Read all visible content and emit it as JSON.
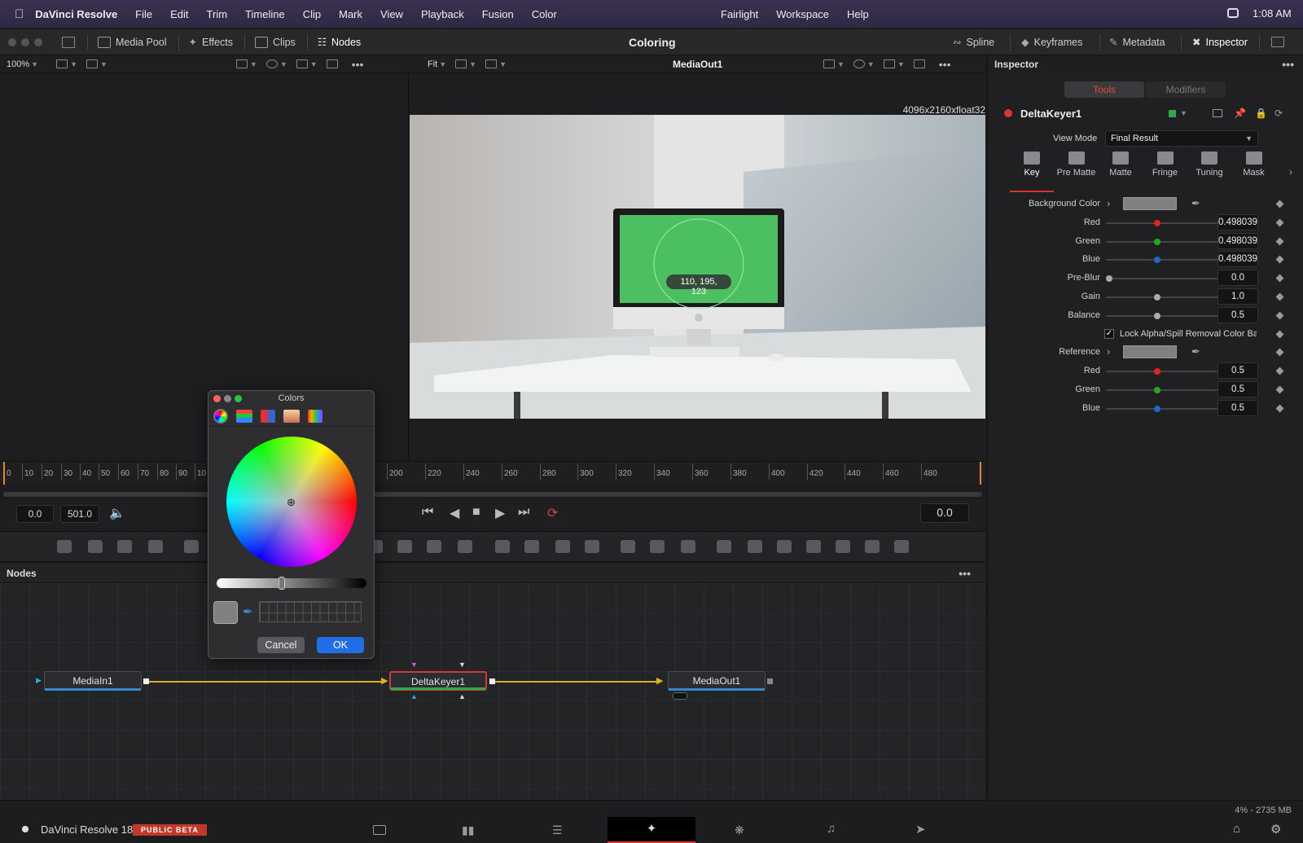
{
  "menubar": {
    "app_name": "DaVinci Resolve",
    "menus": [
      "File",
      "Edit",
      "Trim",
      "Timeline",
      "Clip",
      "Mark",
      "View",
      "Playback",
      "Fusion",
      "Color"
    ],
    "right_menus": [
      "Fairlight",
      "Workspace",
      "Help"
    ],
    "clock": "1:08 AM"
  },
  "toolbar": {
    "left": [
      "Media Pool",
      "Effects",
      "Clips",
      "Nodes"
    ],
    "title": "Coloring",
    "right": [
      "Spline",
      "Keyframes",
      "Metadata",
      "Inspector"
    ]
  },
  "viewer_left": {
    "zoom": "100%"
  },
  "viewer_right": {
    "fit": "Fit",
    "name": "MediaOut1",
    "resolution": "4096x2160xfloat32",
    "sample_readout": "110, 195, 123"
  },
  "timeline": {
    "labels": [
      "0",
      "10",
      "20",
      "30",
      "40",
      "50",
      "60",
      "70",
      "80",
      "90",
      "10",
      "200",
      "220",
      "240",
      "260",
      "280",
      "300",
      "320",
      "340",
      "360",
      "380",
      "400",
      "420",
      "440",
      "460",
      "480"
    ]
  },
  "transport": {
    "start": "0.0",
    "end": "501.0",
    "current": "0.0"
  },
  "nodes_panel": {
    "title": "Nodes",
    "nodes": [
      {
        "label": "MediaIn1",
        "bar_color": "#3a88c8"
      },
      {
        "label": "DeltaKeyer1",
        "bar_color": "#2fa84a"
      },
      {
        "label": "MediaOut1",
        "bar_color": "#3a88c8"
      }
    ]
  },
  "colors_dialog": {
    "title": "Colors",
    "cancel": "Cancel",
    "ok": "OK"
  },
  "inspector": {
    "title": "Inspector",
    "tab_tools": "Tools",
    "tab_modifiers": "Modifiers",
    "node_name": "DeltaKeyer1",
    "view_mode_label": "View Mode",
    "view_mode_value": "Final Result",
    "subtabs": [
      "Key",
      "Pre Matte",
      "Matte",
      "Fringe",
      "Tuning",
      "Mask"
    ],
    "active_subtab": "Key",
    "params": [
      {
        "label": "Background Color",
        "type": "swatch"
      },
      {
        "label": "Red",
        "value": "0.498039",
        "knob_color": "#d22",
        "pos": 0.45
      },
      {
        "label": "Green",
        "value": "0.498039",
        "knob_color": "#2a2",
        "pos": 0.45
      },
      {
        "label": "Blue",
        "value": "0.498039",
        "knob_color": "#26c",
        "pos": 0.45
      },
      {
        "label": "Pre-Blur",
        "value": "0.0",
        "knob_color": "#aaa",
        "pos": 0.0
      },
      {
        "label": "Gain",
        "value": "1.0",
        "knob_color": "#aaa",
        "pos": 0.45
      },
      {
        "label": "Balance",
        "value": "0.5",
        "knob_color": "#aaa",
        "pos": 0.45
      },
      {
        "label": "Lock Alpha/Spill Removal Color Bal",
        "type": "checkbox",
        "checked": true
      },
      {
        "label": "Reference",
        "type": "swatch"
      },
      {
        "label": "Red",
        "value": "0.5",
        "knob_color": "#d22",
        "pos": 0.45
      },
      {
        "label": "Green",
        "value": "0.5",
        "knob_color": "#2a2",
        "pos": 0.45
      },
      {
        "label": "Blue",
        "value": "0.5",
        "knob_color": "#26c",
        "pos": 0.45
      }
    ]
  },
  "status": {
    "app_label": "DaVinci Resolve 18",
    "badge": "PUBLIC BETA",
    "memory": "4% - 2735 MB",
    "active_page": "fusion"
  }
}
